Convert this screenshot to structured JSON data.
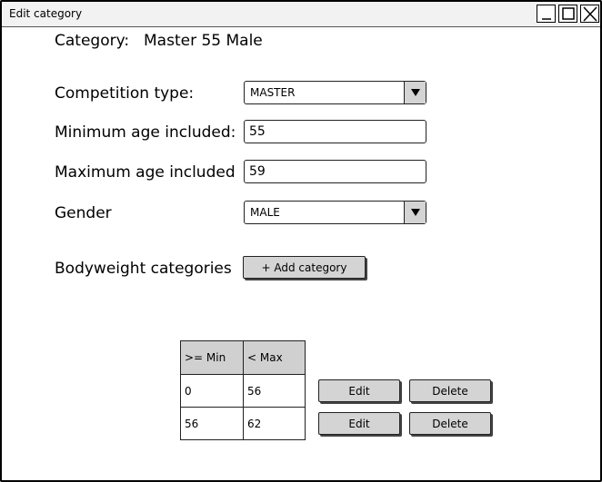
{
  "window": {
    "title": "Edit category",
    "controls": {
      "minimize": "_",
      "maximize": "□",
      "close": "×"
    }
  },
  "category": {
    "label": "Category:",
    "value": "Master 55 Male"
  },
  "form": {
    "competition_type": {
      "label": "Competition type:",
      "value": "MASTER"
    },
    "min_age": {
      "label": "Minimum age included:",
      "value": "55"
    },
    "max_age": {
      "label": "Maximum age included",
      "value": "59"
    },
    "gender": {
      "label": "Gender",
      "value": "MALE"
    }
  },
  "bodyweight": {
    "label": "Bodyweight categories",
    "add_button": "+ Add category",
    "columns": [
      ">= Min",
      "< Max"
    ],
    "rows": [
      {
        "min": "0",
        "max": "56"
      },
      {
        "min": "56",
        "max": "62"
      }
    ],
    "edit_label": "Edit",
    "delete_label": "Delete"
  },
  "colors": {
    "button_fill": "#d4d4d4",
    "header_fill": "#d0d0d0",
    "border": "#222222"
  }
}
